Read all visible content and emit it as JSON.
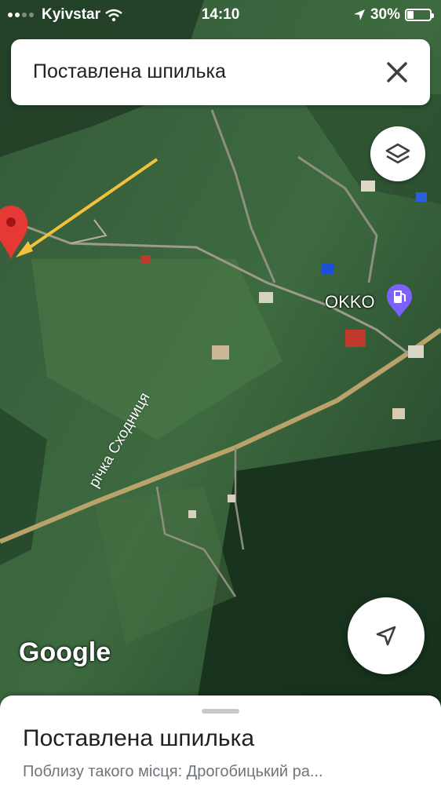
{
  "status_bar": {
    "carrier": "Kyivstar",
    "time": "14:10",
    "battery_percent_label": "30%",
    "battery_level": 0.3
  },
  "search": {
    "title": "Поставлена шпилька"
  },
  "map": {
    "poi_name": "OKKO",
    "river_label": "річка Сходниця",
    "logo": "Google",
    "pin_color": "#e53935",
    "arrow_color": "#f2c33a"
  },
  "sheet": {
    "title": "Поставлена шпилька",
    "subtitle": "Поблизу такого місця: Дрогобицький ра..."
  },
  "icons": {
    "close": "close-icon",
    "layers": "layers-icon",
    "locate": "navigation-arrow-icon",
    "fuel": "gas-station-icon",
    "pin": "map-pin-icon"
  }
}
